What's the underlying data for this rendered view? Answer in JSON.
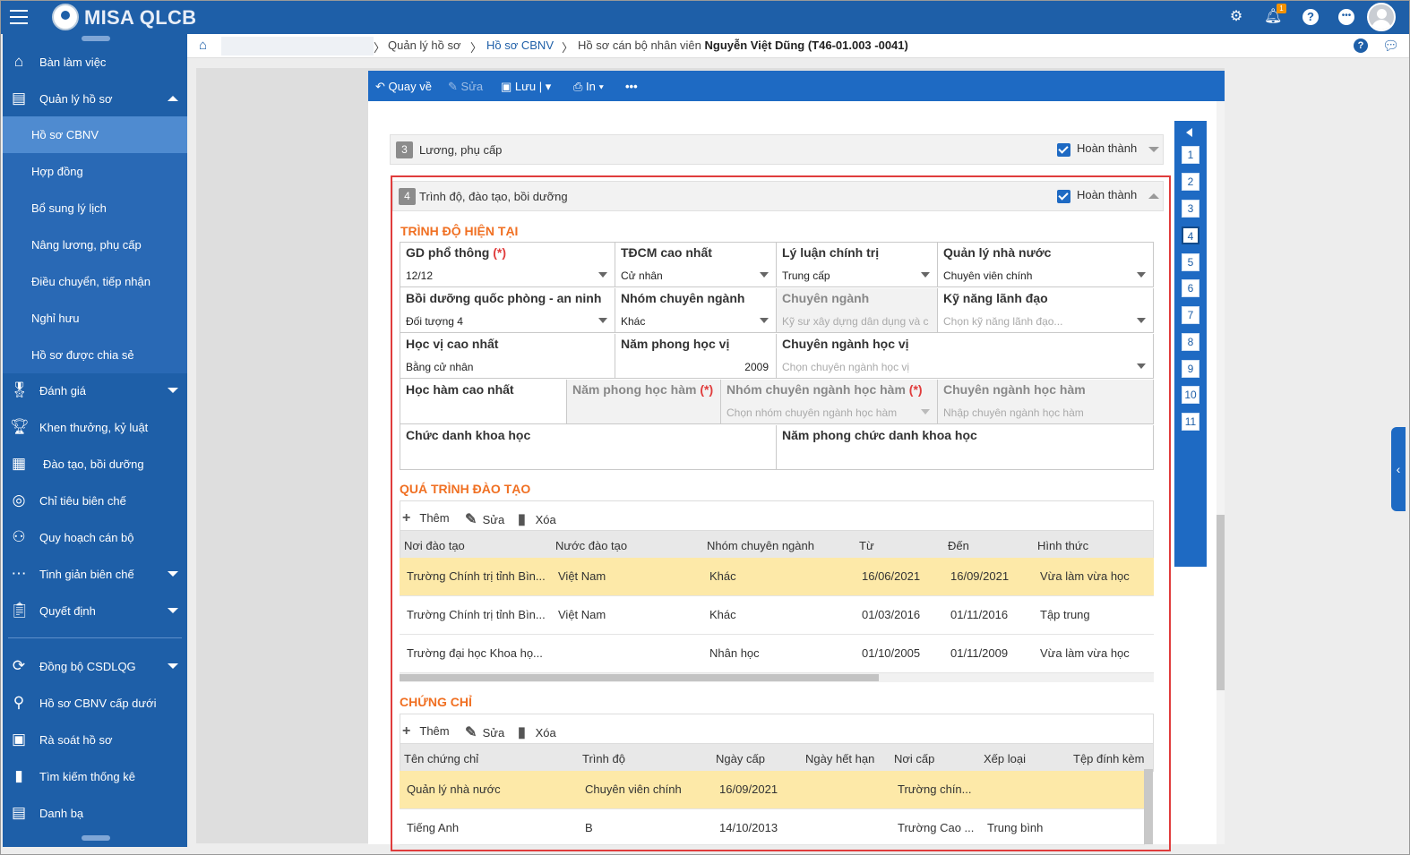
{
  "app": {
    "brand": "MISA QLCB",
    "notification_count": "1"
  },
  "breadcrumb": {
    "items": [
      "Quản lý hồ sơ",
      "Hồ sơ CBNV"
    ],
    "current_prefix": "Hồ sơ cán bộ nhân viên",
    "current_name": "Nguyễn Việt Dũng (T46-01.003 -0041)"
  },
  "sidebar": {
    "items": [
      {
        "label": "Bàn làm việc",
        "icon": "home-icon"
      },
      {
        "label": "Quản lý hồ sơ",
        "icon": "profile-icon"
      },
      {
        "label": "Đánh giá",
        "icon": "medal-icon"
      },
      {
        "label": "Khen thưởng, kỷ luật",
        "icon": "trophy-icon"
      },
      {
        "label": "Đào tạo, bồi dưỡng",
        "icon": "training-icon"
      },
      {
        "label": "Chỉ tiêu biên chế",
        "icon": "target-icon"
      },
      {
        "label": "Quy hoạch cán bộ",
        "icon": "team-icon"
      },
      {
        "label": "Tinh giản biên chế",
        "icon": "more-icon"
      },
      {
        "label": "Quyết định",
        "icon": "clipboard-icon"
      },
      {
        "label": "Đồng bộ CSDLQG",
        "icon": "sync-icon"
      },
      {
        "label": "Hồ sơ CBNV cấp dưới",
        "icon": "search-icon"
      },
      {
        "label": "Rà soát hồ sơ",
        "icon": "review-icon"
      },
      {
        "label": "Tìm kiếm thống kê",
        "icon": "stats-icon"
      },
      {
        "label": "Danh bạ",
        "icon": "contacts-icon"
      }
    ],
    "subitems": [
      "Hồ sơ CBNV",
      "Hợp đồng",
      "Bổ sung lý lịch",
      "Nâng lương, phụ cấp",
      "Điều chuyển, tiếp nhận",
      "Nghỉ hưu",
      "Hồ sơ được chia sẻ"
    ]
  },
  "toolbar": {
    "back": "Quay về",
    "edit": "Sửa",
    "save": "Lưu",
    "print": "In"
  },
  "section_nav": [
    "1",
    "2",
    "3",
    "4",
    "5",
    "6",
    "7",
    "8",
    "9",
    "10",
    "11"
  ],
  "sections": {
    "s3": {
      "num": "3",
      "title": "Lương, phụ cấp",
      "done": "Hoàn thành"
    },
    "s4": {
      "num": "4",
      "title": "Trình độ, đào tạo, bồi dưỡng",
      "done": "Hoàn thành"
    }
  },
  "current_level": {
    "heading": "TRÌNH ĐỘ HIỆN TẠI",
    "ge_label": "GD phổ thông",
    "ge_value": "12/12",
    "tdcm_label": "TĐCM cao nhất",
    "tdcm_value": "Cử nhân",
    "llct_label": "Lý luận chính trị",
    "llct_value": "Trung cấp",
    "qlnn_label": "Quản lý nhà nước",
    "qlnn_value": "Chuyên viên chính",
    "bdqp_label": "Bồi dưỡng quốc phòng - an ninh",
    "bdqp_value": "Đối tượng 4",
    "ncn_label": "Nhóm chuyên ngành",
    "ncn_value": "Khác",
    "cn_label": "Chuyên ngành",
    "cn_value": "Kỹ sư xây dựng dân dụng và c",
    "kn_label": "Kỹ năng lãnh đạo",
    "kn_placeholder": "Chọn kỹ năng lãnh đạo...",
    "hv_label": "Học vị cao nhất",
    "hv_value": "Bằng cử nhân",
    "nphv_label": "Năm phong học vị",
    "nphv_value": "2009",
    "cnhv_label": "Chuyên ngành học vị",
    "cnhv_placeholder": "Chọn chuyên ngành học vị",
    "hh_label": "Học hàm cao nhất",
    "nphh_label": "Năm phong học hàm",
    "ncnhh_label": "Nhóm chuyên ngành học hàm",
    "ncnhh_placeholder": "Chọn nhóm chuyên ngành học hàm",
    "cnhh_label": "Chuyên ngành học hàm",
    "cnhh_placeholder": "Nhập chuyên ngành học hàm",
    "cdkh_label": "Chức danh khoa học",
    "npcd_label": "Năm phong chức danh khoa học",
    "required_mark": "(*)"
  },
  "training": {
    "heading": "QUÁ TRÌNH ĐÀO TẠO",
    "add": "Thêm",
    "edit": "Sửa",
    "delete": "Xóa",
    "columns": [
      "Nơi đào tạo",
      "Nước đào tạo",
      "Nhóm chuyên ngành",
      "Từ",
      "Đến",
      "Hình thức"
    ],
    "rows": [
      [
        "Trường Chính trị tỉnh Bìn...",
        "Việt Nam",
        "Khác",
        "16/06/2021",
        "16/09/2021",
        "Vừa làm vừa học"
      ],
      [
        "Trường Chính trị tỉnh Bìn...",
        "Việt Nam",
        "Khác",
        "01/03/2016",
        "01/11/2016",
        "Tập trung"
      ],
      [
        "Trường đại học Khoa họ...",
        "",
        "Nhân học",
        "01/10/2005",
        "01/11/2009",
        "Vừa làm vừa học"
      ]
    ]
  },
  "certificates": {
    "heading": "CHỨNG CHỈ",
    "add": "Thêm",
    "edit": "Sửa",
    "delete": "Xóa",
    "columns": [
      "Tên chứng chỉ",
      "Trình độ",
      "Ngày cấp",
      "Ngày hết hạn",
      "Nơi cấp",
      "Xếp loại",
      "Tệp đính kèm"
    ],
    "rows": [
      [
        "Quản lý nhà nước",
        "Chuyên viên chính",
        "16/09/2021",
        "",
        "Trường chín...",
        "",
        ""
      ],
      [
        "Tiếng Anh",
        "B",
        "14/10/2013",
        "",
        "Trường Cao ...",
        "Trung bình",
        ""
      ]
    ]
  },
  "colors": {
    "primary": "#1e5fa8",
    "accent": "#f07023",
    "selected_row": "#fde9a8",
    "highlight_border": "#e03c3c"
  }
}
